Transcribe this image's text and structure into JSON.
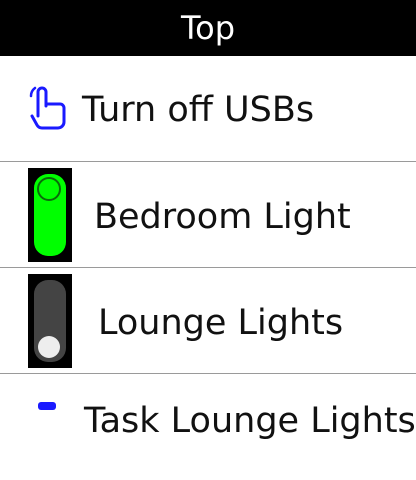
{
  "header": {
    "title": "Top"
  },
  "items": [
    {
      "label": "Turn off USBs",
      "icon": "touch-icon",
      "icon_color": "#1a1aff"
    },
    {
      "label": "Bedroom Light",
      "icon": "toggle-on-icon",
      "state": "on",
      "on_color": "#00ff00"
    },
    {
      "label": "Lounge Lights",
      "icon": "toggle-off-icon",
      "state": "off",
      "off_color": "#444444"
    },
    {
      "label": "Task Lounge Lights",
      "icon": "partial-icon",
      "icon_color": "#1a1aff"
    }
  ]
}
